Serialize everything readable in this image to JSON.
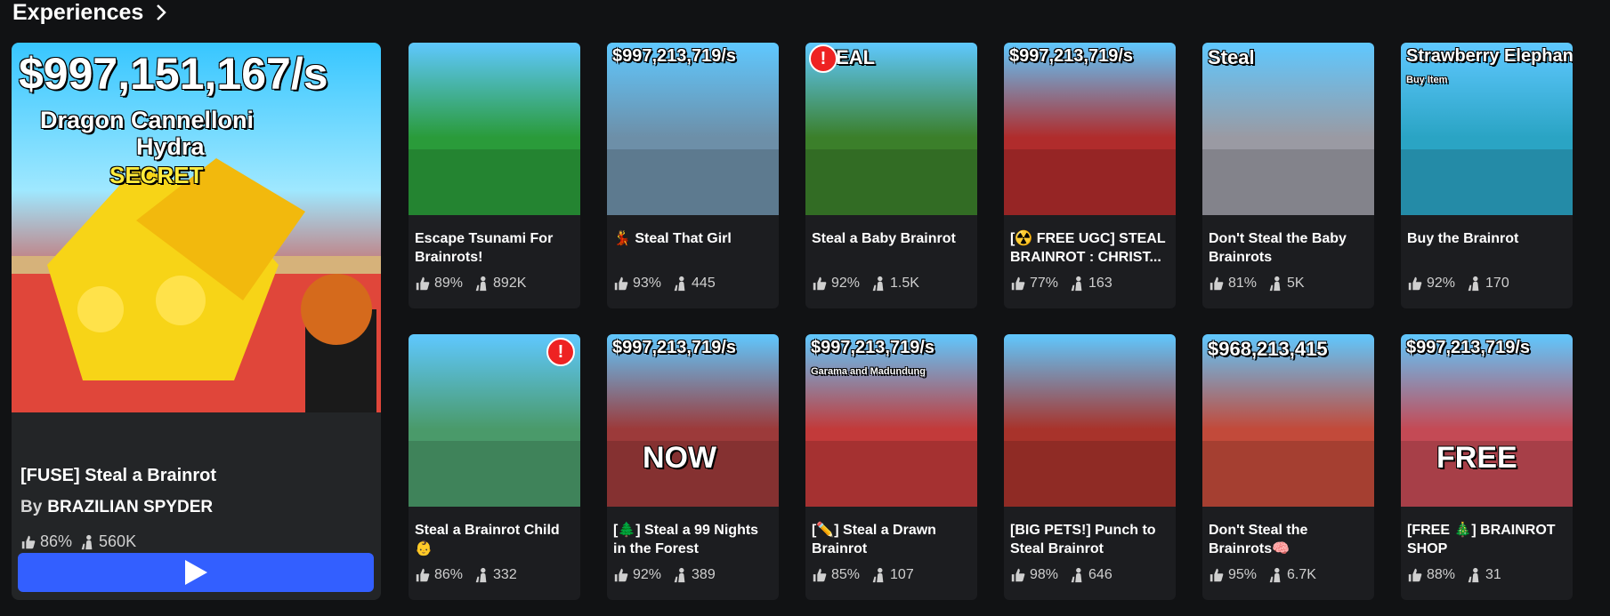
{
  "section": {
    "title": "Experiences"
  },
  "featured": {
    "title": "[FUSE] Steal a Brainrot",
    "by_prefix": "By",
    "creator": "BRAZILIAN SPYDER",
    "rating": "86%",
    "players": "560K",
    "thumb": {
      "money": "$997,151,167/s",
      "line1": "Dragon Cannelloni",
      "line2": "Hydra",
      "rarity": "SECRET"
    }
  },
  "cards": [
    {
      "title": "Escape Tsunami For Brainrots!",
      "rating": "89%",
      "players": "892K",
      "thumb_text": "",
      "bg": "#2a9b3a"
    },
    {
      "title": "💃 Steal That Girl",
      "rating": "93%",
      "players": "445",
      "thumb_text": "$997,213,719/s",
      "bg": "#6d8fa8"
    },
    {
      "title": "Steal a Baby Brainrot",
      "rating": "92%",
      "players": "1.5K",
      "thumb_text": "STEAL",
      "bg": "#3b7f2a"
    },
    {
      "title": "[☢️ FREE UGC] STEAL BRAINROT : CHRIST...",
      "rating": "77%",
      "players": "163",
      "thumb_text": "$997,213,719/s",
      "bg": "#b02c2c"
    },
    {
      "title": "Don't Steal the Baby Brainrots",
      "rating": "81%",
      "players": "5K",
      "thumb_text": "Steal",
      "bg": "#9a9aa3"
    },
    {
      "title": "Buy the Brainrot",
      "rating": "92%",
      "players": "170",
      "thumb_text": "Strawberry Elephant",
      "thumb_sub": "Buy Item",
      "bg": "#2aa4c4"
    },
    {
      "title": "Steal a Brainrot Child👶",
      "rating": "86%",
      "players": "332",
      "thumb_text": "",
      "bg": "#4a9a6a"
    },
    {
      "title": "[🌲] Steal a 99 Nights in the Forest",
      "rating": "92%",
      "players": "389",
      "thumb_text": "$997,213,719/s",
      "thumb_sub": "NOW",
      "bg": "#9c3a3a"
    },
    {
      "title": "[✏️] Steal a Drawn Brainrot",
      "rating": "85%",
      "players": "107",
      "thumb_text": "$997,213,719/s",
      "thumb_sub": "Garama and Madundung",
      "bg": "#c23a3a"
    },
    {
      "title": "[BIG PETS!] Punch to Steal Brainrot",
      "rating": "98%",
      "players": "646",
      "thumb_text": "",
      "bg": "#a8332b"
    },
    {
      "title": "Don't Steal the Brainrots🧠",
      "rating": "95%",
      "players": "6.7K",
      "thumb_text": "$968,213,415",
      "bg": "#c24a3a"
    },
    {
      "title": "[FREE 🎄] BRAINROT SHOP",
      "rating": "88%",
      "players": "31",
      "thumb_text": "$997,213,719/s",
      "thumb_sub": "FREE",
      "bg": "#c44a55"
    }
  ],
  "icons": {
    "rating": "thumbs-up-icon",
    "players": "users-icon",
    "play": "play-icon",
    "chevron": "chevron-right-icon"
  },
  "colors": {
    "accent": "#335fff",
    "background": "#111214",
    "card": "#1c1d20"
  }
}
